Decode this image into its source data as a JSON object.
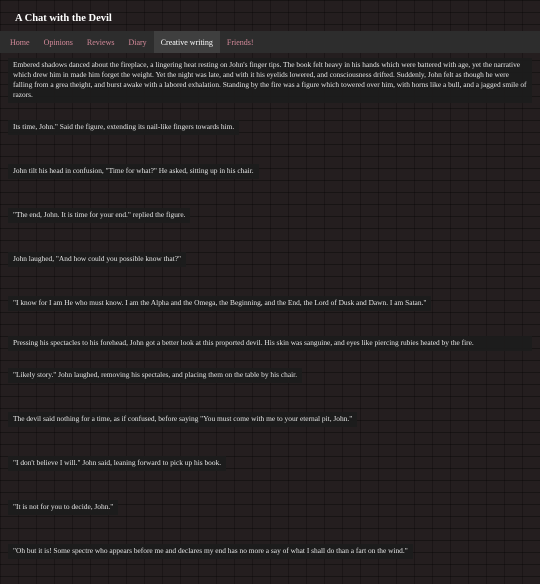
{
  "header": {
    "title": "A Chat with the Devil"
  },
  "nav": {
    "items": [
      {
        "label": "Home"
      },
      {
        "label": "Opinions"
      },
      {
        "label": "Reviews"
      },
      {
        "label": "Diary"
      },
      {
        "label": "Creative writing"
      },
      {
        "label": "Friends!"
      }
    ]
  },
  "story": {
    "paragraphs": [
      "Embered shadows danced about the fireplace, a lingering heat resting on John's finger tips. The book felt heavy in his hands which were battered with age, yet the narrative which drew him in made him forget the weight. Yet the night was late, and with it his eyelids lowered, and consciousness drifted. Suddenly, John felt as though he were falling from a grea theight, and burst awake with a labored exhalation. Standing by the fire was a figure which towered over him, with horns like a bull, and a jagged smile of razors.",
      "Its time, John.\" Said the figure, extending its nail-like fingers towards him.",
      "John tilt his head in confusion, \"Time for what?\" He asked, sitting up in his chair.",
      "\"The end, John. It is time for your end.\" replied the figure.",
      "John laughed, \"And how could you possible know that?\"",
      "\"I know for I am He who must know. I am the Alpha and the Omega, the Beginning, and the End, the Lord of Dusk and Dawn. I am Satan.\"",
      "Pressing his spectacles to his forehead, John got a better look at this proported devil. His skin was sanguine, and eyes like piercing rubies heated by the fire.",
      "\"Likely story.\" John laughed, removing his spectales, and placing them on the table by his chair.",
      "The devil said nothing for a time, as if confused, before saying \"You must come with me to your eternal pit, John.\"",
      "\"I don't believe I will.\" John said, leaning forward to pick up his book.",
      "\"It is not for you to decide, John.\"",
      "\"Oh but it is! Some spectre who appears before me and declares my end has no more a say of what I shall do than a fart on the wind.\""
    ]
  }
}
